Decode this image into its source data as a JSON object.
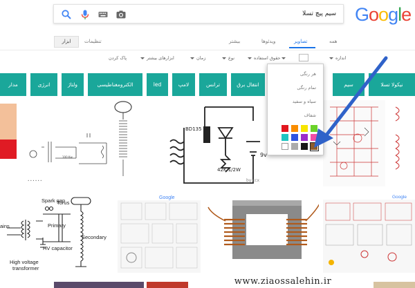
{
  "header": {
    "logo_text": "Google",
    "logo_colors": [
      "#4285f4",
      "#ea4335",
      "#fbbc05",
      "#4285f4",
      "#34a853",
      "#ea4335"
    ],
    "search_query": "سیم پیچ تسلا",
    "icons": [
      "camera-icon",
      "keyboard-icon",
      "mic-icon",
      "search-icon"
    ]
  },
  "tabs": {
    "all": "همه",
    "images": "تصاویر",
    "videos": "ویدئوها",
    "more": "بیشتر",
    "settings": "تنظیمات",
    "tools": "ابزار"
  },
  "filters": {
    "size": "اندازه",
    "usage_rights": "حقوق استفاده",
    "type": "نوع",
    "time": "زمان",
    "more_tools": "ابزارهای بیشتر",
    "clear": "پاک کردن"
  },
  "chips": [
    "نیکولا تسلا",
    "سیم",
    "انتقال برق",
    "ترانس",
    "لامپ",
    "led",
    "الکترومغناطیسی",
    "ولتاژ",
    "انرژی",
    "مدار"
  ],
  "color_dropdown": {
    "items": [
      "هر رنگی",
      "تمام رنگی",
      "سیاه و سفید",
      "شفاف"
    ],
    "swatches": [
      "#e2171f",
      "#f98d00",
      "#f7e500",
      "#6bd22a",
      "#1ec5c2",
      "#2e54e0",
      "#9b2dc9",
      "#f04ea6",
      "#ffffff",
      "#ababab",
      "#181818",
      "#8d5b2b"
    ],
    "accent": "#1aa79a"
  },
  "image_labels": {
    "hv_transformer": "High voltage transformer",
    "spark_gap": "Spark gap",
    "primary": "Primary",
    "secondary": "Secondary",
    "hv_capacitor": "HV capacitor",
    "torus": "Torus",
    "bd135": "BD135",
    "res_42k": "42K 1/2W",
    "v9": "9v",
    "byccx": "by:ccx",
    "ains": "ains"
  },
  "watermark": "www.ziaossalehin.ir"
}
